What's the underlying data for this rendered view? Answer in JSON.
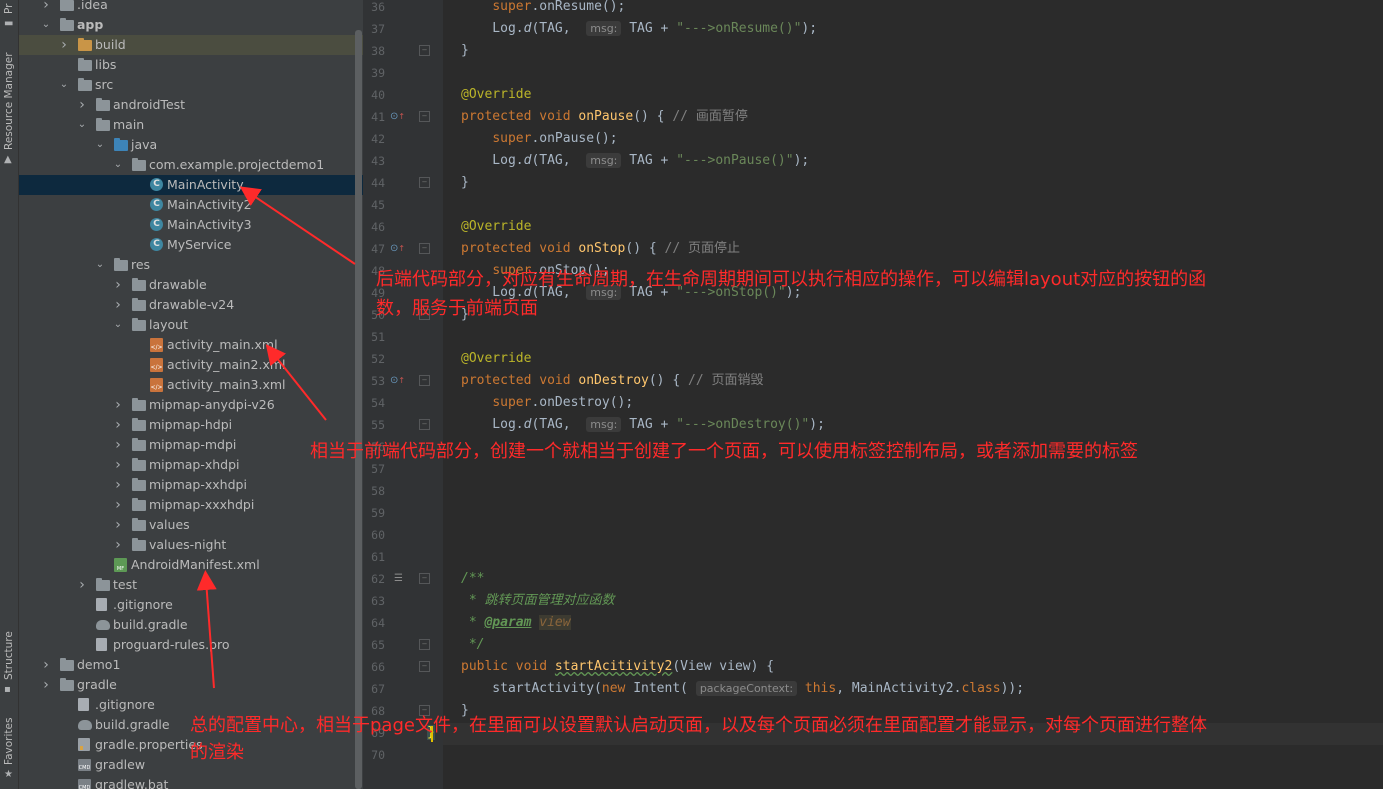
{
  "side_tabs": {
    "project": "Pr",
    "resource_manager": "Resource Manager",
    "structure": "Structure",
    "favorites": "Favorites"
  },
  "tree": [
    {
      "label": ".idea",
      "depth": 0,
      "arrow": "right",
      "icon": "folder"
    },
    {
      "label": "app",
      "depth": 0,
      "arrow": "down",
      "icon": "folder",
      "bold": true
    },
    {
      "label": "build",
      "depth": 1,
      "arrow": "right",
      "icon": "folder-orange",
      "state": "highlighted"
    },
    {
      "label": "libs",
      "depth": 1,
      "arrow": "",
      "icon": "folder"
    },
    {
      "label": "src",
      "depth": 1,
      "arrow": "down",
      "icon": "folder"
    },
    {
      "label": "androidTest",
      "depth": 2,
      "arrow": "right",
      "icon": "folder"
    },
    {
      "label": "main",
      "depth": 2,
      "arrow": "down",
      "icon": "folder"
    },
    {
      "label": "java",
      "depth": 3,
      "arrow": "down",
      "icon": "folder-blue"
    },
    {
      "label": "com.example.projectdemo1",
      "depth": 4,
      "arrow": "down",
      "icon": "folder"
    },
    {
      "label": "MainActivity",
      "depth": 5,
      "arrow": "",
      "icon": "class",
      "state": "selected"
    },
    {
      "label": "MainActivity2",
      "depth": 5,
      "arrow": "",
      "icon": "class"
    },
    {
      "label": "MainActivity3",
      "depth": 5,
      "arrow": "",
      "icon": "class"
    },
    {
      "label": "MyService",
      "depth": 5,
      "arrow": "",
      "icon": "class"
    },
    {
      "label": "res",
      "depth": 3,
      "arrow": "down",
      "icon": "folder"
    },
    {
      "label": "drawable",
      "depth": 4,
      "arrow": "right",
      "icon": "folder"
    },
    {
      "label": "drawable-v24",
      "depth": 4,
      "arrow": "right",
      "icon": "folder"
    },
    {
      "label": "layout",
      "depth": 4,
      "arrow": "down",
      "icon": "folder"
    },
    {
      "label": "activity_main.xml",
      "depth": 5,
      "arrow": "",
      "icon": "xml"
    },
    {
      "label": "activity_main2.xml",
      "depth": 5,
      "arrow": "",
      "icon": "xml"
    },
    {
      "label": "activity_main3.xml",
      "depth": 5,
      "arrow": "",
      "icon": "xml"
    },
    {
      "label": "mipmap-anydpi-v26",
      "depth": 4,
      "arrow": "right",
      "icon": "folder"
    },
    {
      "label": "mipmap-hdpi",
      "depth": 4,
      "arrow": "right",
      "icon": "folder"
    },
    {
      "label": "mipmap-mdpi",
      "depth": 4,
      "arrow": "right",
      "icon": "folder"
    },
    {
      "label": "mipmap-xhdpi",
      "depth": 4,
      "arrow": "right",
      "icon": "folder"
    },
    {
      "label": "mipmap-xxhdpi",
      "depth": 4,
      "arrow": "right",
      "icon": "folder"
    },
    {
      "label": "mipmap-xxxhdpi",
      "depth": 4,
      "arrow": "right",
      "icon": "folder"
    },
    {
      "label": "values",
      "depth": 4,
      "arrow": "right",
      "icon": "folder"
    },
    {
      "label": "values-night",
      "depth": 4,
      "arrow": "right",
      "icon": "folder"
    },
    {
      "label": "AndroidManifest.xml",
      "depth": 3,
      "arrow": "",
      "icon": "manifest"
    },
    {
      "label": "test",
      "depth": 2,
      "arrow": "right",
      "icon": "folder"
    },
    {
      "label": ".gitignore",
      "depth": 2,
      "arrow": "",
      "icon": "file"
    },
    {
      "label": "build.gradle",
      "depth": 2,
      "arrow": "",
      "icon": "gradle"
    },
    {
      "label": "proguard-rules.pro",
      "depth": 2,
      "arrow": "",
      "icon": "file"
    },
    {
      "label": "demo1",
      "depth": 0,
      "arrow": "right",
      "icon": "folder"
    },
    {
      "label": "gradle",
      "depth": 0,
      "arrow": "right",
      "icon": "folder"
    },
    {
      "label": ".gitignore",
      "depth": 1,
      "arrow": "",
      "icon": "file"
    },
    {
      "label": "build.gradle",
      "depth": 1,
      "arrow": "",
      "icon": "gradle"
    },
    {
      "label": "gradle.properties",
      "depth": 1,
      "arrow": "",
      "icon": "props"
    },
    {
      "label": "gradlew",
      "depth": 1,
      "arrow": "",
      "icon": "cmd"
    },
    {
      "label": "gradlew.bat",
      "depth": 1,
      "arrow": "",
      "icon": "cmd"
    }
  ],
  "line_numbers": [
    "36",
    "37",
    "38",
    "39",
    "40",
    "41",
    "42",
    "43",
    "44",
    "45",
    "46",
    "47",
    "48",
    "49",
    "50",
    "51",
    "52",
    "53",
    "54",
    "55",
    "56",
    "57",
    "58",
    "59",
    "60",
    "61",
    "62",
    "63",
    "64",
    "65",
    "66",
    "67",
    "68",
    "69",
    "70"
  ],
  "code": {
    "l36": {
      "pre": "    ",
      "a": "super",
      "b": ".onResume();"
    },
    "l37": {
      "log": "    Log.",
      "d": "d",
      "tag": "(TAG, ",
      "hint": "msg:",
      "rest": " TAG + ",
      "str": "\"--->onResume()\"",
      "end": ");"
    },
    "l38": "}",
    "l40": "@Override",
    "l41": {
      "kw": "protected void ",
      "fn": "onPause",
      "rest": "() { ",
      "cm": "// 画面暂停"
    },
    "l42": {
      "pre": "    ",
      "a": "super",
      "b": ".onPause();"
    },
    "l43": {
      "log": "    Log.",
      "d": "d",
      "tag": "(TAG, ",
      "hint": "msg:",
      "rest": " TAG + ",
      "str": "\"--->onPause()\"",
      "end": ");"
    },
    "l44": "}",
    "l46": "@Override",
    "l47": {
      "kw": "protected void ",
      "fn": "onStop",
      "rest": "() { ",
      "cm": "// 页面停止"
    },
    "l48": {
      "pre": "    ",
      "a": "super",
      "b": ".onStop();"
    },
    "l49": {
      "log": "    Log.",
      "d": "d",
      "tag": "(TAG, ",
      "hint": "msg:",
      "rest": " TAG + ",
      "str": "\"--->onStop()\"",
      "end": ");"
    },
    "l50": "}",
    "l52": "@Override",
    "l53": {
      "kw": "protected void ",
      "fn": "onDestroy",
      "rest": "() { ",
      "cm": "// 页面销毁"
    },
    "l54": {
      "pre": "    ",
      "a": "super",
      "b": ".onDestroy();"
    },
    "l55": {
      "log": "    Log.",
      "d": "d",
      "tag": "(TAG, ",
      "hint": "msg:",
      "rest": " TAG + ",
      "str": "\"--->onDestroy()\"",
      "end": ");"
    },
    "l62": "/**",
    "l63": " * 跳转页面管理对应函数",
    "l64": {
      "pre": " * ",
      "tag": "@param",
      "sp": " ",
      "val": "view"
    },
    "l65": " */",
    "l66": {
      "kw": "public void ",
      "fn": "startAcitivity2",
      "rest": "(View view) {"
    },
    "l67": {
      "pre": "    startActivity(",
      "kw": "new ",
      "cls": "Intent(",
      "hint": "packageContext:",
      "this": " this",
      "rest": ", MainActivity2.",
      "kw2": "class",
      "end": "));"
    },
    "l68": "}",
    "l69": "}"
  },
  "annotations": {
    "backend_line1": "后端代码部分，对应有生命周期，在生命周期期间可以执行相应的操作，可以编辑layout对应的按钮的函",
    "backend_line2": "数，服务于前端页面",
    "frontend": "相当于前端代码部分，创建一个就相当于创建了一个页面，可以使用标签控制布局，或者添加需要的标签",
    "config_line1": "总的配置中心，相当于page文件，在里面可以设置默认启动页面，以及每个页面必须在里面配置才能显示，对每个页面进行整体",
    "config_line2": "的渲染",
    "color": "#ff2a2a"
  },
  "colors": {
    "editor_bg": "#2b2b2b",
    "panel_bg": "#3c3f41",
    "selected_row": "#0d293e",
    "keyword": "#cc7832",
    "function": "#ffc66d",
    "string": "#6a8759"
  }
}
